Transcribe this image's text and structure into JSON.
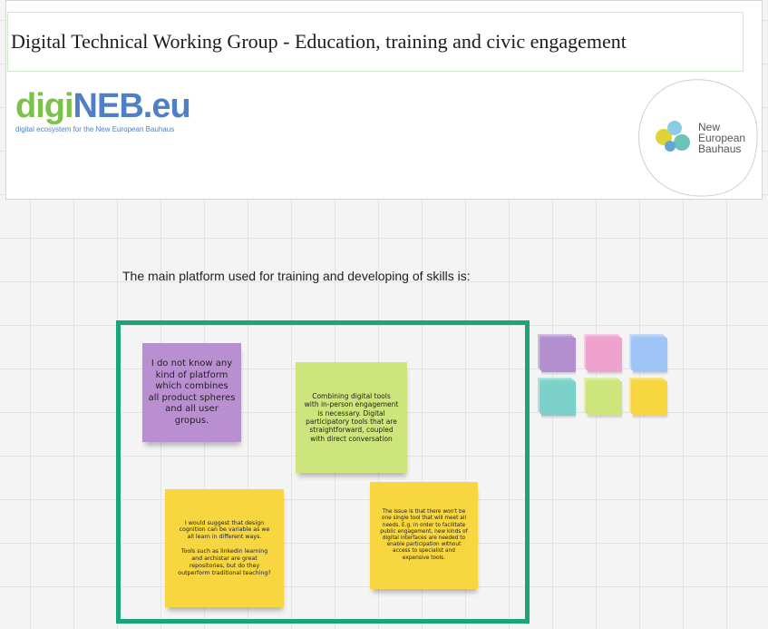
{
  "header": {
    "title": "Digital Technical Working Group - Education, training and civic engagement",
    "logo_diginerb": {
      "part1": "digi",
      "part2": "NEB",
      "part3": ".eu",
      "tagline": "digital ecosystem for the New European Bauhaus"
    },
    "logo_neb": {
      "line1": "New",
      "line2": "European",
      "line3": "Bauhaus"
    }
  },
  "board": {
    "prompt": "The main platform used for training and developing of skills is:",
    "notes": [
      {
        "text": "I do not know any\nkind of platform\nwhich combines\nall product spheres\nand all user\ngropus.",
        "color": "#ba8fd2"
      },
      {
        "text": "Combining digital tools\nwith in-person engagement\nis necessary. Digital\nparticipatory tools that are\nstraightforward, coupled\nwith direct conversation",
        "color": "#cde57b"
      },
      {
        "text": "I would suggest that design\ncognition can be variable as we\nall learn in different ways.\n\nTools such as linkedin learning\nand archistar are great\nrepositories, but do they\noutperform traditional teaching?",
        "color": "#f7d63f"
      },
      {
        "text": "The issue is that there won't be\none single tool that will meet all\nneeds. E.g. in order to facilitate\npublic engagement, new kinds of\ndigital interfaces are needed to\nenable participation without\naccess to specialist and\nexpensive tools.",
        "color": "#f7d63f"
      }
    ],
    "sticky_palette": [
      "#b48fd0",
      "#f0a2cf",
      "#9fc5f6",
      "#7dd1cb",
      "#cde57b",
      "#f7d63f"
    ]
  },
  "colors": {
    "frame": "#1ba37a",
    "title_border": "#c9ecc9"
  }
}
